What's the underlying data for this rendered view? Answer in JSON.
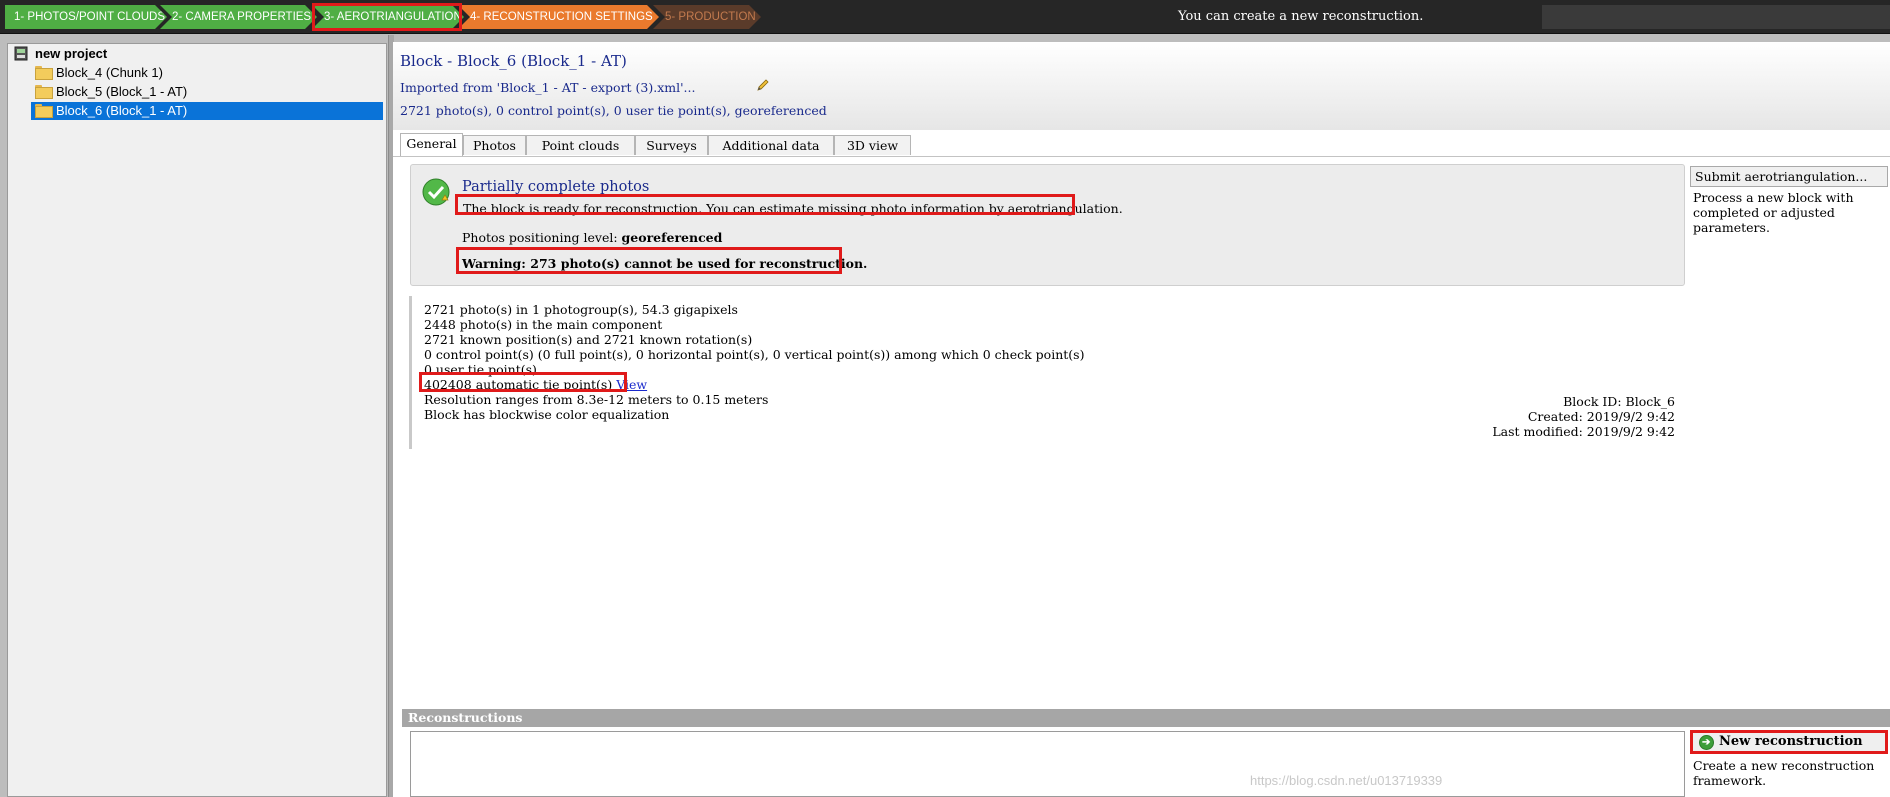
{
  "workflow": {
    "steps": [
      {
        "label": "1- PHOTOS/POINT CLOUDS"
      },
      {
        "label": "2- CAMERA PROPERTIES"
      },
      {
        "label": "3- AEROTRIANGULATION"
      },
      {
        "label": "4- RECONSTRUCTION SETTINGS"
      },
      {
        "label": "5- PRODUCTION"
      }
    ],
    "status": "You can create a new reconstruction."
  },
  "tree": {
    "project": "new project",
    "items": [
      {
        "label": "Block_4 (Chunk 1)"
      },
      {
        "label": "Block_5 (Block_1 - AT)"
      },
      {
        "label": "Block_6 (Block_1 - AT)"
      }
    ]
  },
  "block": {
    "title": "Block - Block_6 (Block_1 - AT)",
    "imported": "Imported from 'Block_1 - AT - export (3).xml'...",
    "summary": "2721 photo(s), 0 control point(s), 0 user tie point(s), georeferenced"
  },
  "tabs": [
    {
      "label": "General"
    },
    {
      "label": "Photos"
    },
    {
      "label": "Point clouds"
    },
    {
      "label": "Surveys"
    },
    {
      "label": "Additional data"
    },
    {
      "label": "3D view"
    }
  ],
  "status": {
    "title": "Partially complete photos",
    "ready": "The block is ready for reconstruction. You can estimate missing photo information by aerotriangulation.",
    "positioning_label": "Photos positioning level:",
    "positioning_value": "georeferenced",
    "warning": "Warning: 273 photo(s) cannot be used for reconstruction."
  },
  "details": {
    "lines": [
      "2721 photo(s) in 1 photogroup(s), 54.3 gigapixels",
      "2448 photo(s) in the main component",
      "2721 known position(s) and 2721 known rotation(s)",
      "0 control point(s) (0 full point(s), 0 horizontal point(s), 0 vertical point(s)) among which 0 check point(s)",
      "0 user tie point(s)"
    ],
    "tie_points": "402408 automatic tie point(s)",
    "view_link": "View",
    "resolution": "Resolution ranges from 8.3e-12 meters to 0.15 meters",
    "equalization": "Block has blockwise color equalization",
    "block_id": "Block ID: Block_6",
    "created": "Created: 2019/9/2 9:42",
    "modified": "Last modified: 2019/9/2 9:42"
  },
  "actions": {
    "submit_label": "Submit aerotriangulation...",
    "submit_desc": "Process a new block with completed or adjusted parameters.",
    "new_recon_label": "New reconstruction",
    "new_recon_desc": "Create a new reconstruction framework."
  },
  "reconstructions": {
    "header": "Reconstructions"
  },
  "watermark": "https://blog.csdn.net/u013719339",
  "colors": {
    "step_done": "#4fae44",
    "step_current": "#ea7a2d",
    "highlight_red": "#e01a1a",
    "selection_blue": "#0a73d8",
    "title_blue": "#1a2a8c"
  }
}
